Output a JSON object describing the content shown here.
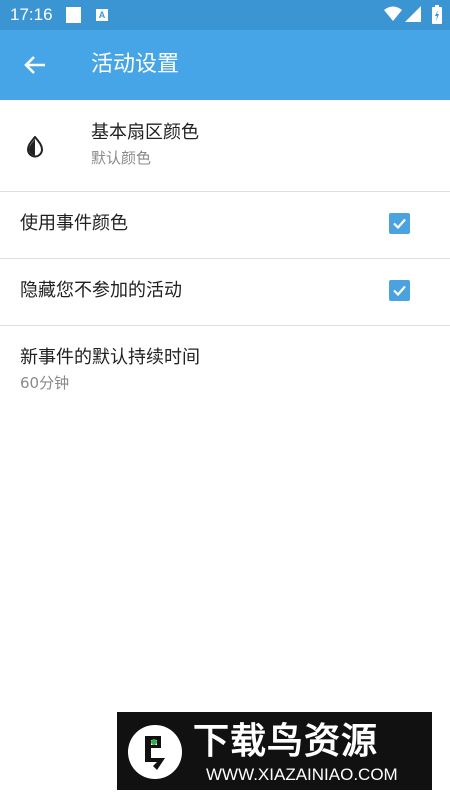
{
  "status_bar": {
    "time": "17:16",
    "a_badge": "A",
    "icons": [
      "square-icon",
      "a-notification-icon",
      "wifi-icon",
      "signal-icon",
      "battery-icon"
    ]
  },
  "app_bar": {
    "back_icon": "arrow-left-icon",
    "title": "活动设置"
  },
  "settings": {
    "sector_color": {
      "icon": "palette-half-icon",
      "title": "基本扇区颜色",
      "subtitle": "默认颜色"
    },
    "use_event_color": {
      "title": "使用事件颜色",
      "checked": true
    },
    "hide_declined": {
      "title": "隐藏您不参加的活动",
      "checked": true
    },
    "default_duration": {
      "title": "新事件的默认持续时间",
      "subtitle": "60分钟"
    }
  },
  "watermark": {
    "title": "下载鸟资源",
    "url": "WWW.XIAZAINIAO.COM"
  },
  "colors": {
    "status_bar": "#3c95d3",
    "app_bar": "#45a5e6",
    "checkbox": "#4aa3de",
    "divider": "#dedede",
    "subtitle": "#8a8a8a"
  }
}
